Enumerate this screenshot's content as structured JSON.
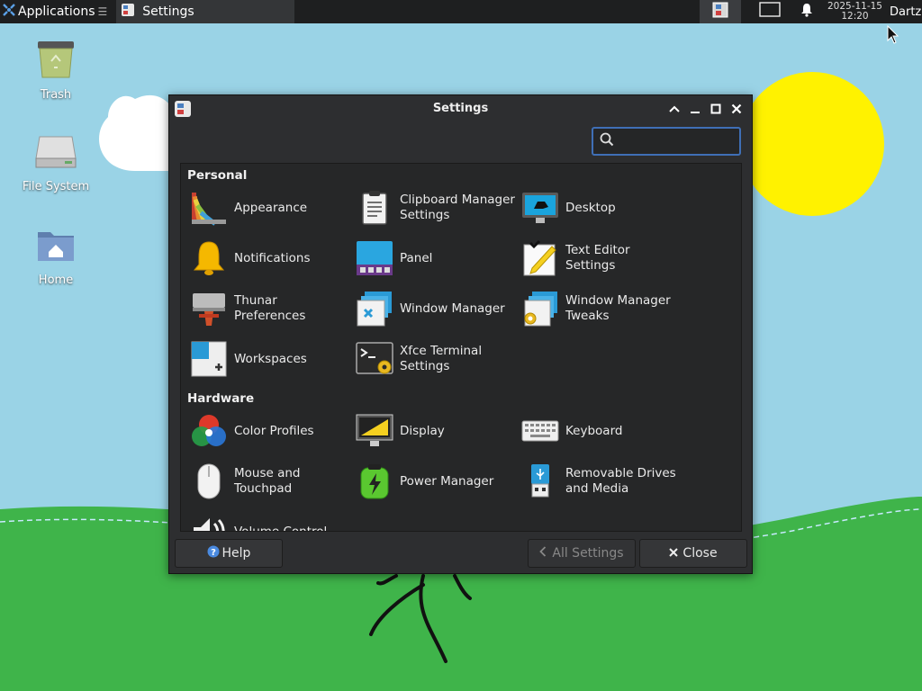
{
  "panel": {
    "applications_label": "Applications",
    "task_label": "Settings",
    "clock_date": "2025-11-15",
    "clock_time": "12:20",
    "user": "Dartz"
  },
  "desktop_icons": [
    {
      "label": "Trash",
      "icon": "trash-icon"
    },
    {
      "label": "File System",
      "icon": "drive-icon"
    },
    {
      "label": "Home",
      "icon": "home-folder-icon"
    }
  ],
  "window": {
    "title": "Settings",
    "search": {
      "value": "",
      "placeholder": ""
    },
    "sections": [
      {
        "title": "Personal",
        "items": [
          {
            "label": "Appearance",
            "icon": "appearance-icon"
          },
          {
            "label": "Clipboard Manager Settings",
            "icon": "clipboard-icon"
          },
          {
            "label": "Desktop",
            "icon": "desktop-icon"
          },
          {
            "label": "Notifications",
            "icon": "bell-icon"
          },
          {
            "label": "Panel",
            "icon": "panel-icon"
          },
          {
            "label": "Text Editor Settings",
            "icon": "text-editor-icon"
          },
          {
            "label": "Thunar Preferences",
            "icon": "thunar-icon"
          },
          {
            "label": "Window Manager",
            "icon": "window-manager-icon"
          },
          {
            "label": "Window Manager Tweaks",
            "icon": "wm-tweaks-icon"
          },
          {
            "label": "Workspaces",
            "icon": "workspaces-icon"
          },
          {
            "label": "Xfce Terminal Settings",
            "icon": "terminal-icon"
          }
        ]
      },
      {
        "title": "Hardware",
        "items": [
          {
            "label": "Color Profiles",
            "icon": "color-profiles-icon"
          },
          {
            "label": "Display",
            "icon": "display-icon"
          },
          {
            "label": "Keyboard",
            "icon": "keyboard-icon"
          },
          {
            "label": "Mouse and Touchpad",
            "icon": "mouse-icon"
          },
          {
            "label": "Power Manager",
            "icon": "battery-icon"
          },
          {
            "label": "Removable Drives and Media",
            "icon": "usb-icon"
          },
          {
            "label": "Volume Control",
            "icon": "volume-icon"
          }
        ]
      }
    ],
    "buttons": {
      "help": "Help",
      "all_settings": "All Settings",
      "close": "Close"
    }
  },
  "colors": {
    "panel_bg": "#1e1f20",
    "window_bg": "#2d2e30",
    "accent": "#3f6fb6",
    "sky": "#9ad3e6",
    "grass": "#3fb44a",
    "sun": "#fff200"
  }
}
